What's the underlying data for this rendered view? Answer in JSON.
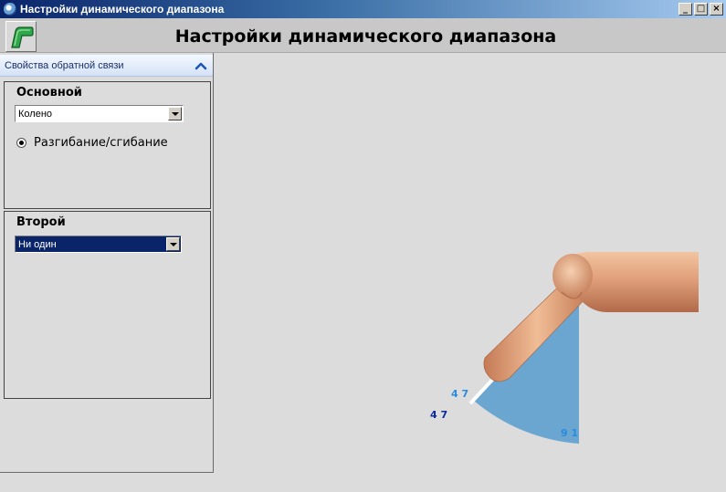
{
  "window": {
    "title": "Настройки динамического диапазона",
    "buttons": [
      "_",
      "□",
      "×"
    ]
  },
  "header": {
    "title": "Настройки динамического диапазона",
    "logo_icon": "green-device-icon"
  },
  "feedback_panel": {
    "title": "Свойства обратной связи",
    "collapse_icon": "chevron-up-icon",
    "primary": {
      "legend": "Основной",
      "joint_select": "Колено",
      "motion_radio": "Разгибание/сгибание"
    },
    "secondary": {
      "legend": "Второй",
      "select_value": "Ни один"
    }
  },
  "viewport": {
    "limit_min_inner": "4 7",
    "limit_min_outer": "4 7",
    "limit_max": "9 1",
    "arc_color": "#6aa6d0",
    "label_color_light": "#2a8ae0",
    "label_color_dark": "#0a2aa0"
  }
}
